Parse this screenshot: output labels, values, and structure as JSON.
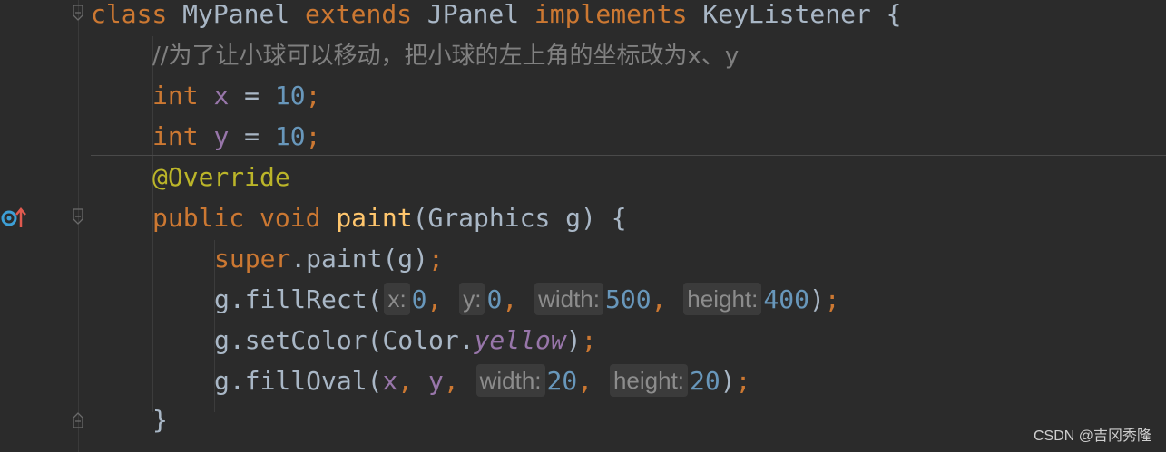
{
  "editor": {
    "lines": {
      "l1": {
        "kw_class": "class",
        "name": "MyPanel",
        "kw_extends": "extends",
        "parent": "JPanel",
        "kw_impl": "implements",
        "iface": "KeyListener",
        "brace": "{"
      },
      "l2": {
        "comment": "//为了让小球可以移动，把小球的左上角的坐标改为x、y"
      },
      "l3": {
        "type": "int",
        "var": "x",
        "eq": "=",
        "val": "10",
        "semi": ";"
      },
      "l4": {
        "type": "int",
        "var": "y",
        "eq": "=",
        "val": "10",
        "semi": ";"
      },
      "l5": {
        "annotation": "@Override"
      },
      "l6": {
        "kw_public": "public",
        "kw_void": "void",
        "method": "paint",
        "params": "(Graphics g) {"
      },
      "l7": {
        "kw_super": "super",
        "rest": ".paint(g)",
        "semi": ";"
      },
      "l8": {
        "prefix": "g.fillRect(",
        "hint_x": "x:",
        "val_x": "0",
        "c1": ",",
        "hint_y": "y:",
        "val_y": "0",
        "c2": ",",
        "hint_w": "width:",
        "val_w": "500",
        "c3": ",",
        "hint_h": "height:",
        "val_h": "400",
        "suffix": ")",
        "semi": ";"
      },
      "l9": {
        "prefix": "g.setColor(Color.",
        "field": "yellow",
        "suffix": ")",
        "semi": ";"
      },
      "l10": {
        "prefix": "g.fillOval(",
        "arg_x": "x",
        "c1": ",",
        "arg_y": "y",
        "c2": ",",
        "hint_w": "width:",
        "val_w": "20",
        "c3": ",",
        "hint_h": "height:",
        "val_h": "20",
        "suffix": ")",
        "semi": ";"
      },
      "l11": {
        "brace": "}"
      }
    }
  },
  "watermark": "CSDN @吉冈秀隆",
  "colors": {
    "background": "#2b2b2b",
    "keyword": "#cc7832",
    "number": "#6897bb",
    "field": "#9876aa",
    "comment": "#808080",
    "annotation": "#bbb529",
    "method": "#ffc66d",
    "text": "#a9b7c6"
  },
  "icons": [
    "override-method-icon",
    "fold-marker-icon"
  ]
}
